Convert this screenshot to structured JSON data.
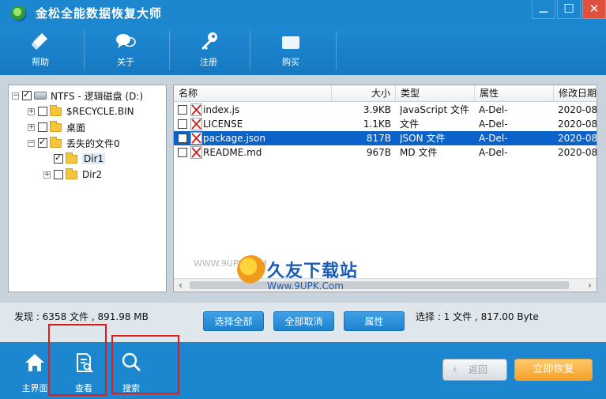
{
  "window": {
    "title": "金松全能数据恢复大师",
    "controls": [
      "⚊",
      "☐",
      "✕"
    ]
  },
  "toolbar": [
    {
      "label": "帮助",
      "icon": "eraser-icon"
    },
    {
      "label": "关于",
      "icon": "chat-bubbles-icon"
    },
    {
      "label": "注册",
      "icon": "key-icon"
    },
    {
      "label": "购买",
      "icon": "buy-box-icon"
    }
  ],
  "tree": [
    {
      "label": "NTFS - 逻辑磁盘 (D:)",
      "checked": true
    },
    {
      "label": "$RECYCLE.BIN",
      "checked": false
    },
    {
      "label": "桌面",
      "checked": false
    },
    {
      "label": "丢失的文件0",
      "checked": true
    },
    {
      "label": "Dir1",
      "checked": true,
      "selected": true
    },
    {
      "label": "Dir2",
      "checked": false
    }
  ],
  "files": {
    "columns": [
      "名称",
      "大小",
      "类型",
      "属性",
      "修改日期"
    ],
    "rows": [
      {
        "name": "index.js",
        "size": "3.9KB",
        "type": "JavaScript 文件",
        "attr": "A-Del-",
        "date": "2020-08-",
        "checked": false,
        "selected": false
      },
      {
        "name": "LICENSE",
        "size": "1.1KB",
        "type": "文件",
        "attr": "A-Del-",
        "date": "2020-08-",
        "checked": false,
        "selected": false
      },
      {
        "name": "package.json",
        "size": "817B",
        "type": "JSON 文件",
        "attr": "A-Del-",
        "date": "2020-08-",
        "checked": true,
        "selected": true
      },
      {
        "name": "README.md",
        "size": "967B",
        "type": "MD 文件",
        "attr": "A-Del-",
        "date": "2020-08-",
        "checked": false,
        "selected": false
      }
    ]
  },
  "watermark": {
    "small": "WWW.9UPK.COM",
    "big": "久友下载站",
    "url": "Www.9UPK.Com"
  },
  "status": {
    "found": "发现 : 6358 文件 , 891.98 MB",
    "selected": "选择 : 1 文件 , 817.00 Byte",
    "buttons": {
      "select_all": "选择全部",
      "deselect_all": "全部取消",
      "properties": "属性"
    }
  },
  "bottom": {
    "nav": [
      {
        "label": "主界面",
        "icon": "home-icon"
      },
      {
        "label": "查看",
        "icon": "view-document-icon"
      },
      {
        "label": "搜索",
        "icon": "search-icon"
      }
    ],
    "back": "返回",
    "recover": "立即恢复"
  },
  "colors": {
    "accent": "#1c86cf",
    "selection": "#0b63c9",
    "recover": "#f4a02a",
    "highlight": "#e11a1a"
  }
}
